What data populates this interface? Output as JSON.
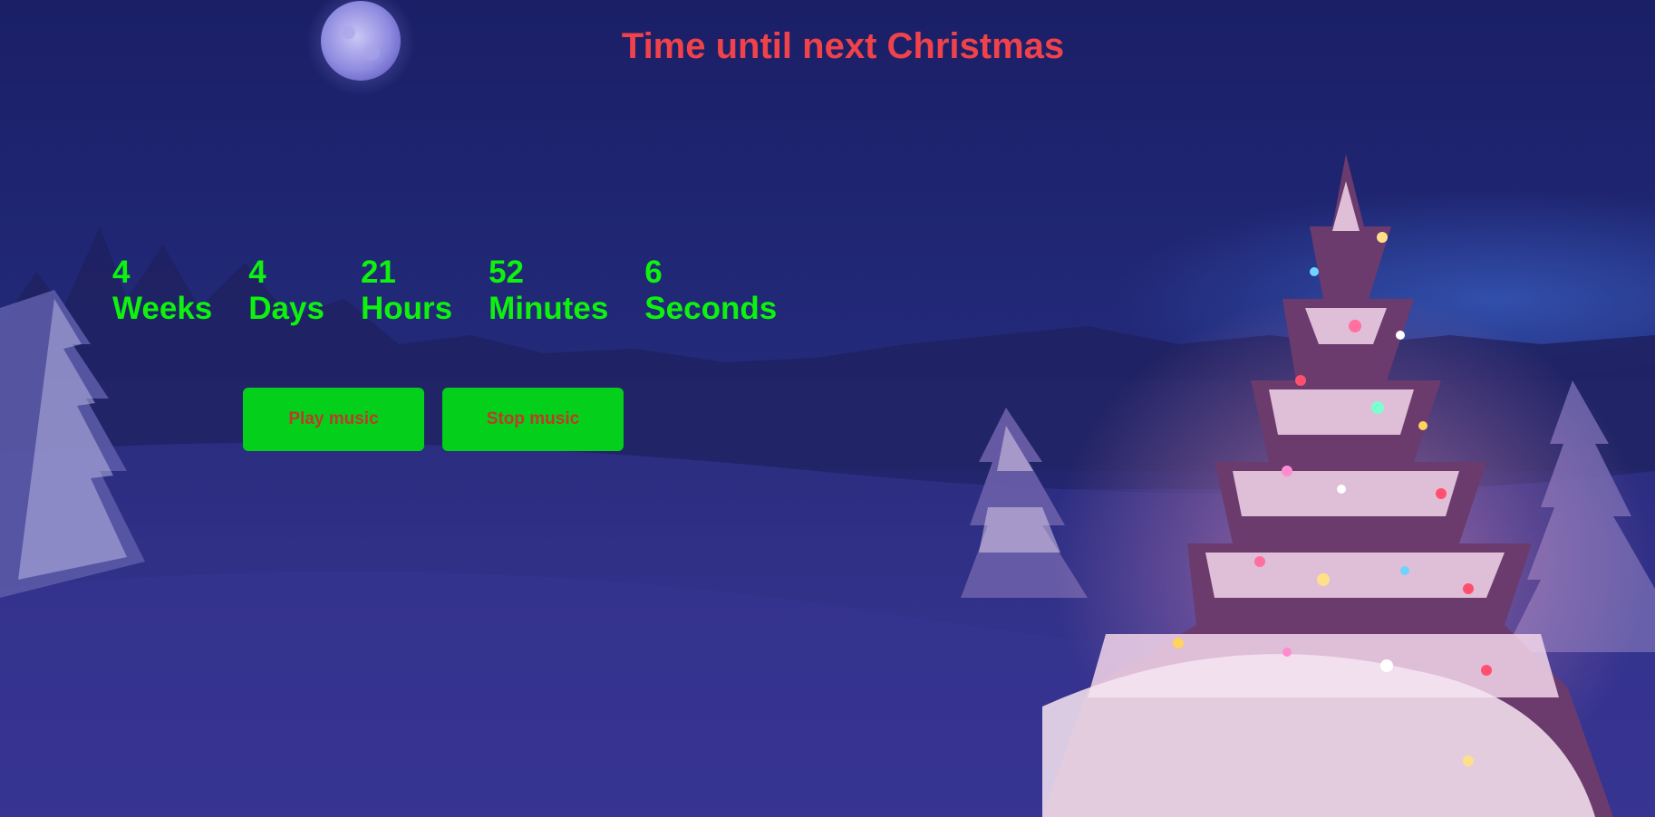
{
  "page": {
    "title": "Time until next Christmas"
  },
  "countdown": [
    {
      "value": "4",
      "unit": "Weeks"
    },
    {
      "value": "4",
      "unit": "Days"
    },
    {
      "value": "21",
      "unit": "Hours"
    },
    {
      "value": "52",
      "unit": "Minutes"
    },
    {
      "value": "6",
      "unit": "Seconds"
    }
  ],
  "controls": {
    "play_label": "Play music",
    "stop_label": "Stop music"
  },
  "colors": {
    "title": "#f0424a",
    "countdown_text": "#0ef20e",
    "button_bg": "#04cf1b",
    "button_text": "#c0392b",
    "sky": "#1f2468"
  }
}
